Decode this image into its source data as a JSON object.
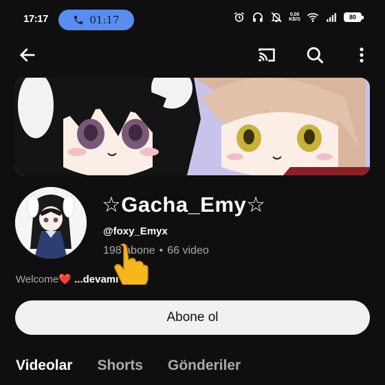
{
  "status_bar": {
    "time": "17:17",
    "call_time": "01:17",
    "battery": "80",
    "net_speed_value": "0,00",
    "net_speed_unit": "KB/S"
  },
  "app_bar": {
    "back_icon": "arrow-left-icon",
    "cast_icon": "cast-icon",
    "search_icon": "search-icon",
    "more_icon": "more-vert-icon"
  },
  "channel": {
    "name": "☆Gacha_Emy☆",
    "handle": "@foxy_Emyx",
    "subscribers": "198 abone",
    "separator": "•",
    "videos": "66 video",
    "description_text": "Welcome",
    "description_heart": "❤️",
    "description_more": " ...devamı"
  },
  "subscribe": {
    "label": "Abone ol"
  },
  "tabs": [
    {
      "label": "Videolar",
      "active": true
    },
    {
      "label": "Shorts",
      "active": false
    },
    {
      "label": "Gönderiler",
      "active": false
    }
  ],
  "colors": {
    "background": "#0f0f0f",
    "call_pill": "#5a8df0",
    "subscribe_bg": "#f1f1f1",
    "secondary_text": "#aaaaaa"
  }
}
